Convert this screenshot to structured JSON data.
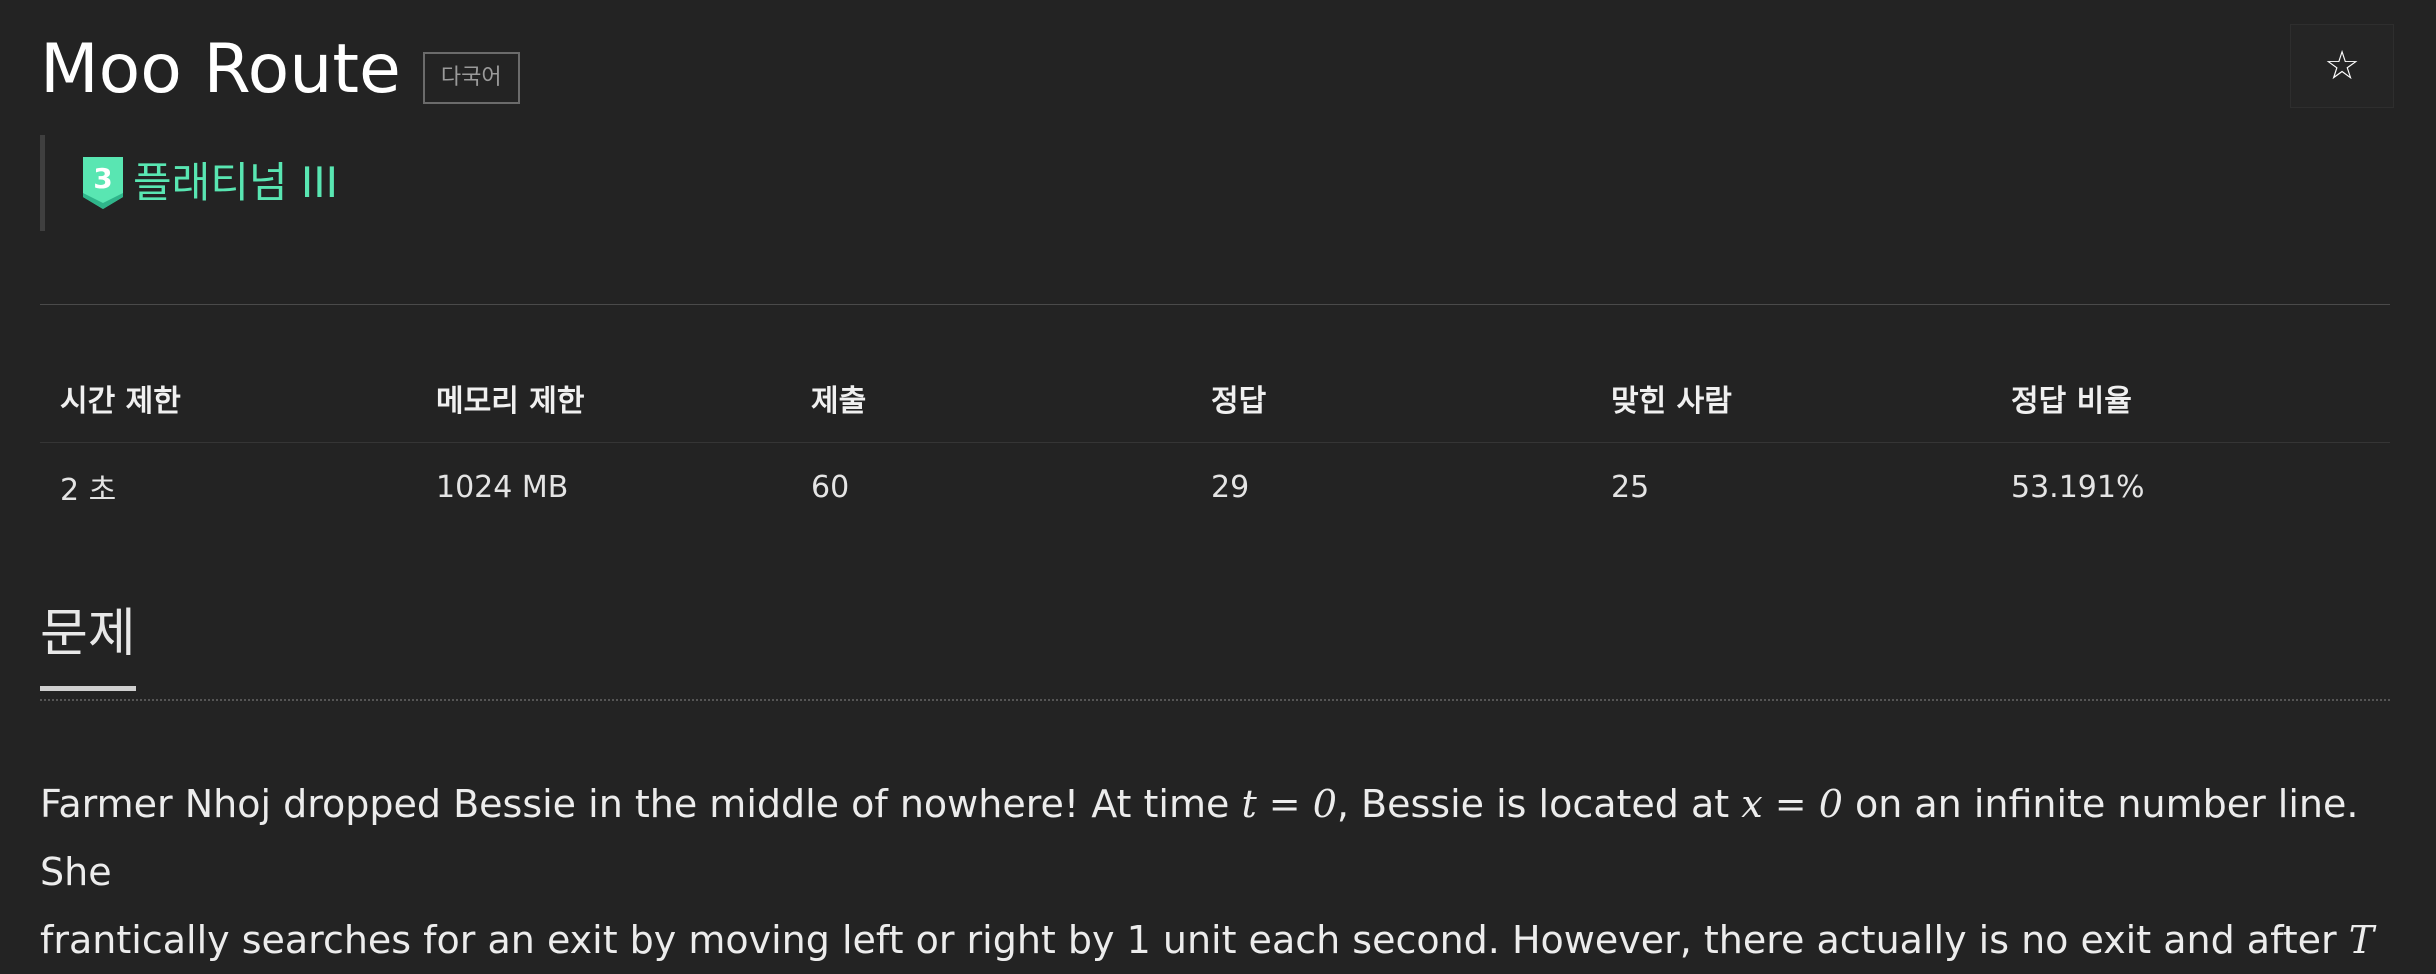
{
  "header": {
    "title": "Moo Route",
    "language_badge": "다국어",
    "star_icon": "☆"
  },
  "tier": {
    "level": "3",
    "label": "플래티넘 III",
    "color": "#59e6b2"
  },
  "stats": {
    "headers": [
      "시간 제한",
      "메모리 제한",
      "제출",
      "정답",
      "맞힌 사람",
      "정답 비율"
    ],
    "values": [
      "2 초",
      "1024 MB",
      "60",
      "29",
      "25",
      "53.191%"
    ]
  },
  "problem": {
    "section_title": "문제",
    "line1": {
      "part1": "Farmer Nhoj dropped Bessie in the middle of nowhere! At time ",
      "math1": "t = 0",
      "part2": ", Bessie is located at ",
      "math2": "x = 0",
      "part3": " on an infinite number line. She"
    },
    "line2": {
      "part1": "frantically searches for an exit by moving left or right by 1 unit each second. However, there actually is no exit and after ",
      "math1": "T"
    }
  }
}
